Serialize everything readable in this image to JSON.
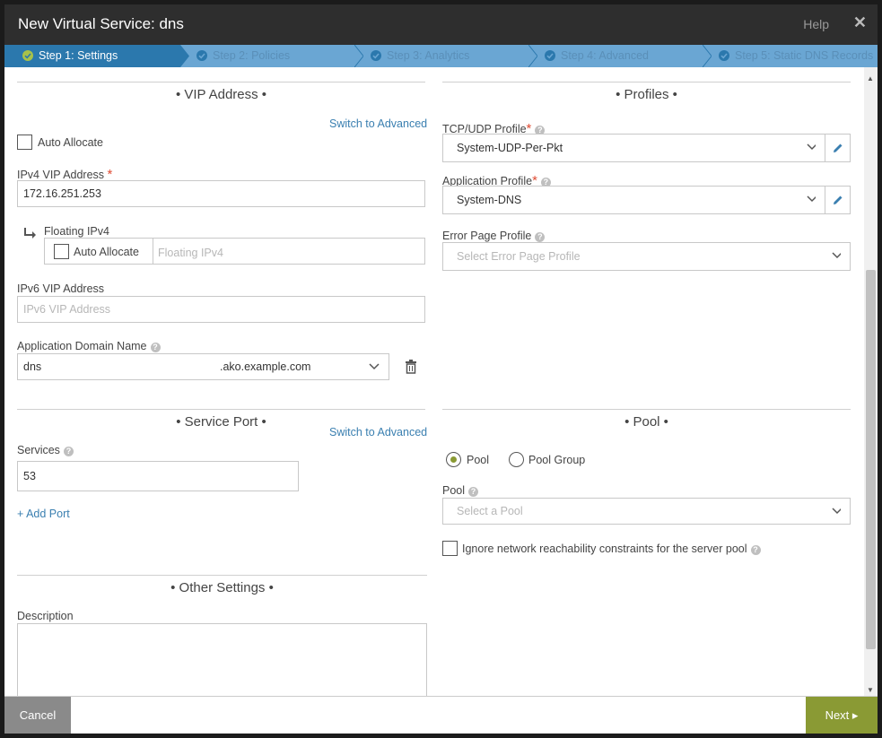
{
  "window": {
    "title": "New Virtual Service: dns",
    "help_label": "Help",
    "close_glyph": "✕"
  },
  "steps": [
    {
      "label": "Step 1: Settings",
      "active": true
    },
    {
      "label": "Step 2: Policies",
      "active": false
    },
    {
      "label": "Step 3: Analytics",
      "active": false
    },
    {
      "label": "Step 4: Advanced",
      "active": false
    },
    {
      "label": "Step 5: Static DNS Records",
      "active": false
    }
  ],
  "vip": {
    "section_title": "• VIP Address •",
    "switch_link": "Switch to Advanced",
    "auto_allocate_label": "Auto Allocate",
    "ipv4_label": "IPv4 VIP Address",
    "ipv4_value": "172.16.251.253",
    "floating_label": "Floating IPv4",
    "floating_auto_label": "Auto Allocate",
    "floating_placeholder": "Floating IPv4",
    "ipv6_label": "IPv6 VIP Address",
    "ipv6_placeholder": "IPv6 VIP Address",
    "domain_label": "Application Domain Name",
    "domain_value": "dns",
    "domain_suffix": ".ako.example.com"
  },
  "profiles": {
    "section_title": "• Profiles •",
    "tcp_label": "TCP/UDP Profile",
    "tcp_value": "System-UDP-Per-Pkt",
    "app_label": "Application Profile",
    "app_value": "System-DNS",
    "error_label": "Error Page Profile",
    "error_placeholder": "Select Error Page Profile"
  },
  "service_port": {
    "section_title": "• Service Port •",
    "switch_link": "Switch to Advanced",
    "services_label": "Services",
    "services_value": "53",
    "add_port": "+ Add Port"
  },
  "pool": {
    "section_title": "• Pool •",
    "radio_pool": "Pool",
    "radio_pool_group": "Pool Group",
    "pool_label": "Pool",
    "pool_placeholder": "Select a Pool",
    "ignore_label": "Ignore network reachability constraints for the server pool"
  },
  "other": {
    "section_title": "• Other Settings •",
    "description_label": "Description"
  },
  "footer": {
    "cancel_label": "Cancel",
    "next_label": "Next ▸"
  },
  "colors": {
    "titlebar": "#2e2e2e",
    "step_active": "#2b78ad",
    "step_bar": "#6aa6d3",
    "link": "#3a7fb0",
    "required": "#e04d35",
    "next_button": "#8a9a34",
    "cancel_button": "#8a8a8a"
  }
}
